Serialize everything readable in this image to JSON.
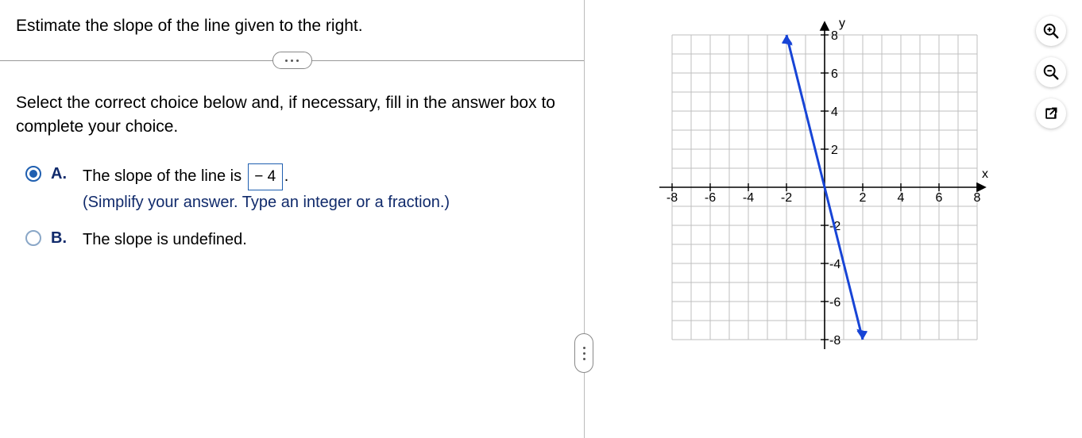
{
  "question": "Estimate the slope of the line given to the right.",
  "instruction": "Select the correct choice below and, if necessary, fill in the answer box to complete your choice.",
  "choices": {
    "A": {
      "label": "A.",
      "text_before": "The slope of the line is ",
      "answer": "− 4",
      "text_after": ".",
      "hint": "(Simplify your answer. Type an integer or a fraction.)",
      "selected": true
    },
    "B": {
      "label": "B.",
      "text": "The slope is undefined.",
      "selected": false
    }
  },
  "graph": {
    "x_label": "x",
    "y_label": "y",
    "ticks": {
      "neg8": "-8",
      "neg6": "-6",
      "neg4": "-4",
      "neg2": "-2",
      "pos2": "2",
      "pos4": "4",
      "pos6": "6",
      "pos8": "8"
    },
    "y_ticks": {
      "p8": "8",
      "p6": "6",
      "p4": "4",
      "p2": "2",
      "n2": "-2",
      "n4": "-4",
      "n6": "-6",
      "n8": "-8"
    }
  },
  "chart_data": {
    "type": "line",
    "title": "",
    "xlabel": "x",
    "ylabel": "y",
    "xlim": [
      -8,
      8
    ],
    "ylim": [
      -8,
      8
    ],
    "grid": true,
    "series": [
      {
        "name": "line",
        "x": [
          -2,
          2
        ],
        "y": [
          8,
          -8
        ],
        "slope": -4
      }
    ]
  },
  "tools": {
    "zoom_in": "zoom-in",
    "zoom_out": "zoom-out",
    "popout": "open-in-new"
  }
}
